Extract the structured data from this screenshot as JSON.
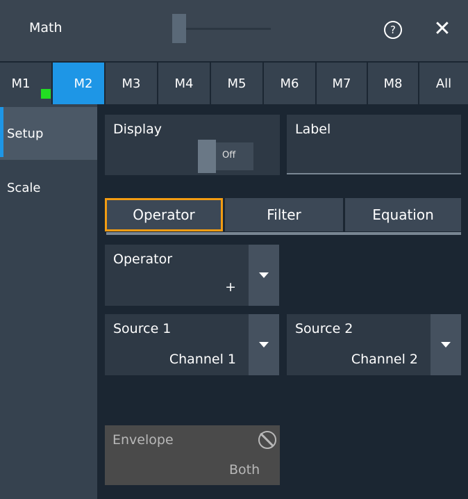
{
  "window": {
    "title": "Math",
    "help_glyph": "?",
    "close_glyph": "✕"
  },
  "tabs": [
    {
      "label": "M1"
    },
    {
      "label": "M2"
    },
    {
      "label": "M3"
    },
    {
      "label": "M4"
    },
    {
      "label": "M5"
    },
    {
      "label": "M6"
    },
    {
      "label": "M7"
    },
    {
      "label": "M8"
    },
    {
      "label": "All"
    }
  ],
  "active_tab": "M2",
  "sidebar": {
    "items": [
      {
        "label": "Setup"
      },
      {
        "label": "Scale"
      }
    ],
    "active": "Setup"
  },
  "display": {
    "label": "Display",
    "state": "Off"
  },
  "label_field": {
    "label": "Label",
    "value": ""
  },
  "segments": [
    {
      "label": "Operator"
    },
    {
      "label": "Filter"
    },
    {
      "label": "Equation"
    }
  ],
  "active_segment": "Operator",
  "operator": {
    "label": "Operator",
    "value": "+"
  },
  "source1": {
    "label": "Source 1",
    "value": "Channel 1"
  },
  "source2": {
    "label": "Source 2",
    "value": "Channel 2"
  },
  "envelope": {
    "label": "Envelope",
    "value": "Both"
  },
  "colors": {
    "accent": "#1e96e6",
    "focus": "#f39c12",
    "indicator": "#22dd22",
    "background": "#1b2632"
  },
  "icons": {
    "help": "help-icon",
    "close": "close-icon",
    "dropdown": "chevron-down-icon",
    "disabled": "prohibited-icon"
  }
}
